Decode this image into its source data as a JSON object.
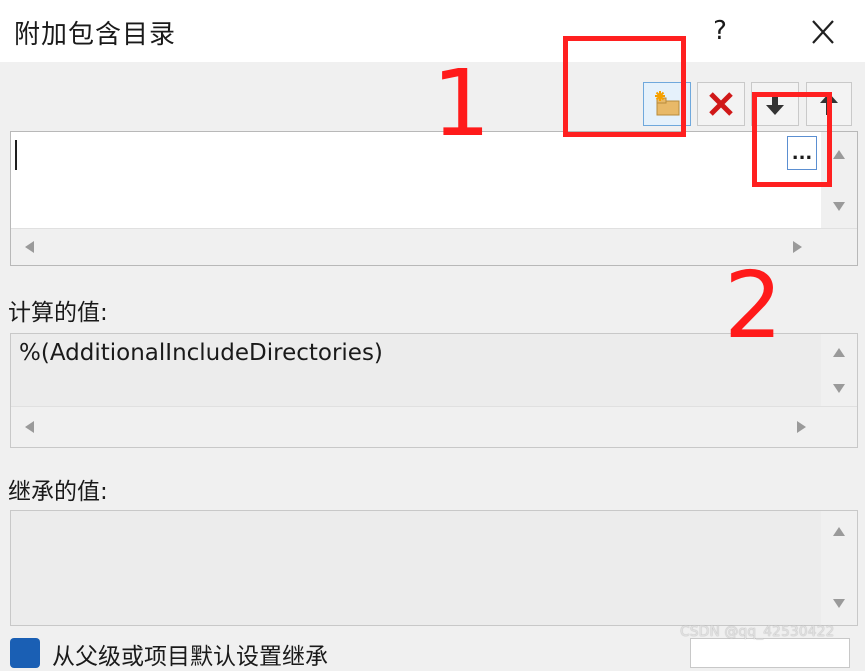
{
  "dialog": {
    "title": "附加包含目录",
    "help_label": "?"
  },
  "toolbar": {
    "buttons": [
      {
        "name": "new-line",
        "icon": "new-folder-icon"
      },
      {
        "name": "delete",
        "icon": "red-x-icon"
      },
      {
        "name": "move-down",
        "icon": "arrow-down-icon"
      },
      {
        "name": "move-up",
        "icon": "arrow-up-icon"
      }
    ]
  },
  "editor": {
    "value": "",
    "browse_label": "..."
  },
  "computed": {
    "label": "计算的值:",
    "value": "%(AdditionalIncludeDirectories)"
  },
  "inherited": {
    "label": "继承的值:",
    "value": ""
  },
  "bottom": {
    "checkbox_label": "从父级或项目默认设置继承"
  },
  "annotations": {
    "marker_1": "1",
    "marker_2": "2",
    "color": "#ff2020"
  },
  "watermark": "CSDN @qq_42530422",
  "colors": {
    "accent": "#1a5fb4",
    "annotation_red": "#ff2020"
  }
}
